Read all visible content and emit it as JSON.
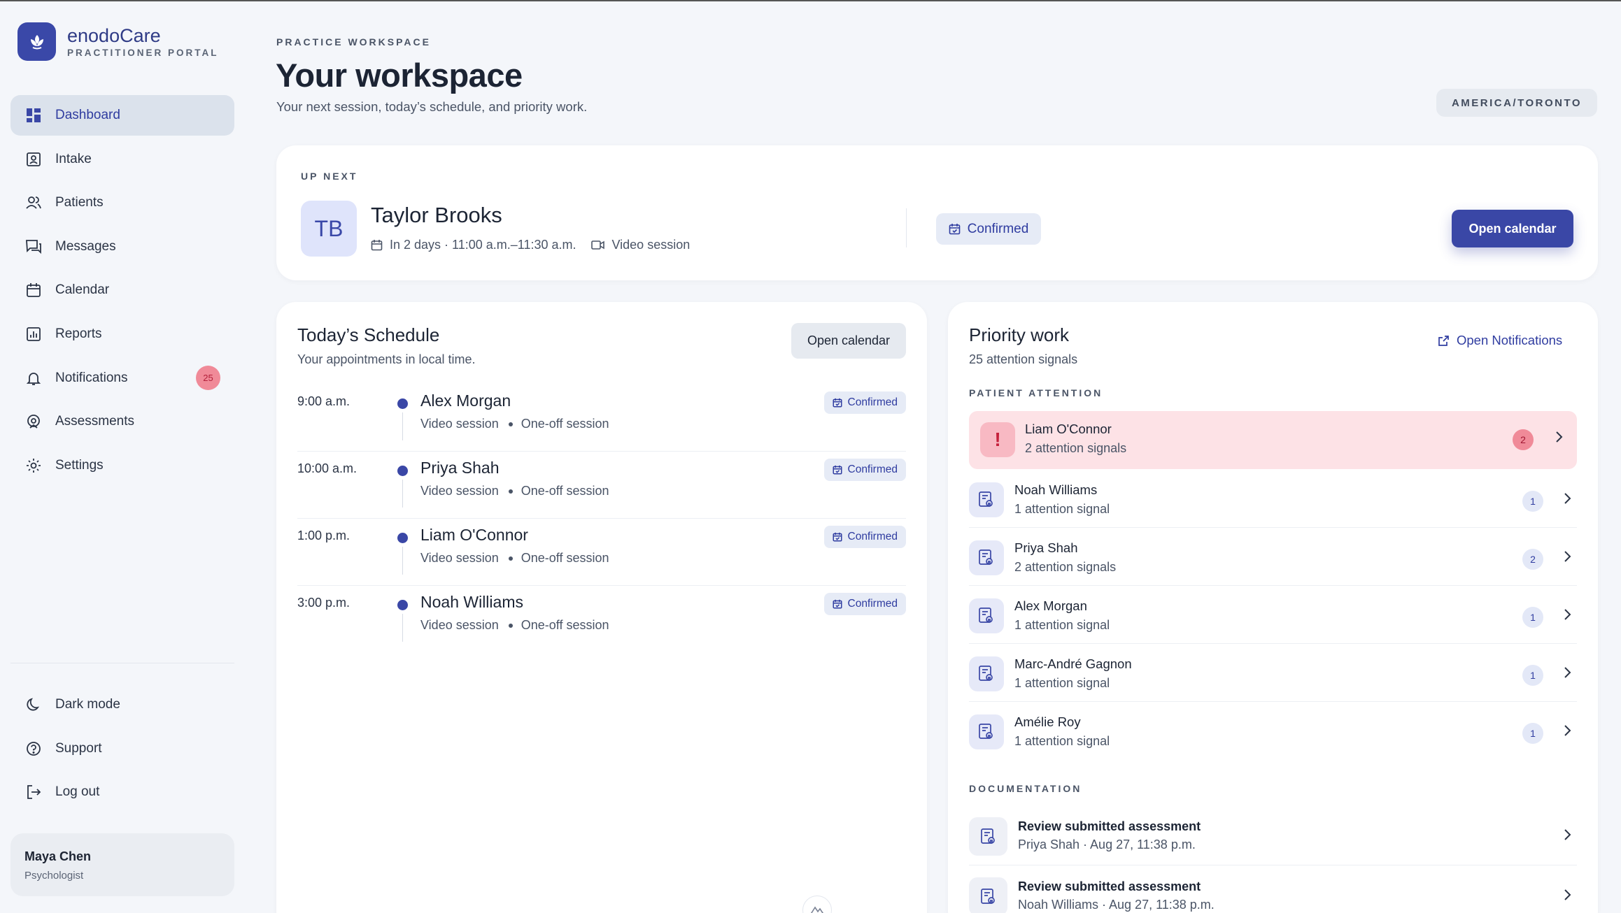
{
  "brand": {
    "name": "enodoCare",
    "subtitle": "PRACTITIONER PORTAL"
  },
  "colors": {
    "accent": "#3a47a6",
    "alert": "#f08a98",
    "alert_bg": "#fde2e6",
    "chip_bg": "#e6ebf6"
  },
  "sidebar": {
    "items": [
      {
        "label": "Dashboard",
        "icon": "dashboard-icon",
        "active": true
      },
      {
        "label": "Intake",
        "icon": "intake-icon"
      },
      {
        "label": "Patients",
        "icon": "patients-icon"
      },
      {
        "label": "Messages",
        "icon": "messages-icon"
      },
      {
        "label": "Calendar",
        "icon": "calendar-icon"
      },
      {
        "label": "Reports",
        "icon": "reports-icon"
      },
      {
        "label": "Notifications",
        "icon": "bell-icon",
        "badge": "25"
      },
      {
        "label": "Assessments",
        "icon": "assessments-icon"
      },
      {
        "label": "Settings",
        "icon": "gear-icon"
      }
    ],
    "bottom": [
      {
        "label": "Dark mode",
        "icon": "moon-icon"
      },
      {
        "label": "Support",
        "icon": "help-icon"
      },
      {
        "label": "Log out",
        "icon": "logout-icon"
      }
    ],
    "user": {
      "name": "Maya Chen",
      "role": "Psychologist"
    }
  },
  "header": {
    "kicker": "PRACTICE WORKSPACE",
    "title": "Your workspace",
    "subtitle": "Your next session, today’s schedule, and priority work.",
    "timezone": "AMERICA/TORONTO"
  },
  "up_next": {
    "label": "UP NEXT",
    "initials": "TB",
    "name": "Taylor Brooks",
    "when": "In 2 days · 11:00 a.m.–11:30 a.m.",
    "mode": "Video session",
    "status": "Confirmed",
    "button": "Open calendar"
  },
  "schedule": {
    "title": "Today’s Schedule",
    "subtitle": "Your appointments in local time.",
    "button": "Open calendar",
    "appointments": [
      {
        "time": "9:00 a.m.",
        "name": "Alex Morgan",
        "mode": "Video session",
        "type": "One-off session",
        "status": "Confirmed"
      },
      {
        "time": "10:00 a.m.",
        "name": "Priya Shah",
        "mode": "Video session",
        "type": "One-off session",
        "status": "Confirmed"
      },
      {
        "time": "1:00 p.m.",
        "name": "Liam O'Connor",
        "mode": "Video session",
        "type": "One-off session",
        "status": "Confirmed"
      },
      {
        "time": "3:00 p.m.",
        "name": "Noah Williams",
        "mode": "Video session",
        "type": "One-off session",
        "status": "Confirmed"
      }
    ]
  },
  "priority": {
    "title": "Priority work",
    "subtitle": "25 attention signals",
    "link": "Open Notifications",
    "patient_label": "PATIENT ATTENTION",
    "patients": [
      {
        "name": "Liam O'Connor",
        "signals": "2 attention signals",
        "count": "2",
        "alert": true
      },
      {
        "name": "Noah Williams",
        "signals": "1 attention signal",
        "count": "1"
      },
      {
        "name": "Priya Shah",
        "signals": "2 attention signals",
        "count": "2"
      },
      {
        "name": "Alex Morgan",
        "signals": "1 attention signal",
        "count": "1"
      },
      {
        "name": "Marc-André Gagnon",
        "signals": "1 attention signal",
        "count": "1"
      },
      {
        "name": "Amélie Roy",
        "signals": "1 attention signal",
        "count": "1"
      }
    ],
    "doc_label": "DOCUMENTATION",
    "docs": [
      {
        "title": "Review submitted assessment",
        "sub": "Priya Shah · Aug 27, 11:38 p.m."
      },
      {
        "title": "Review submitted assessment",
        "sub": "Noah Williams · Aug 27, 11:38 p.m."
      }
    ]
  }
}
